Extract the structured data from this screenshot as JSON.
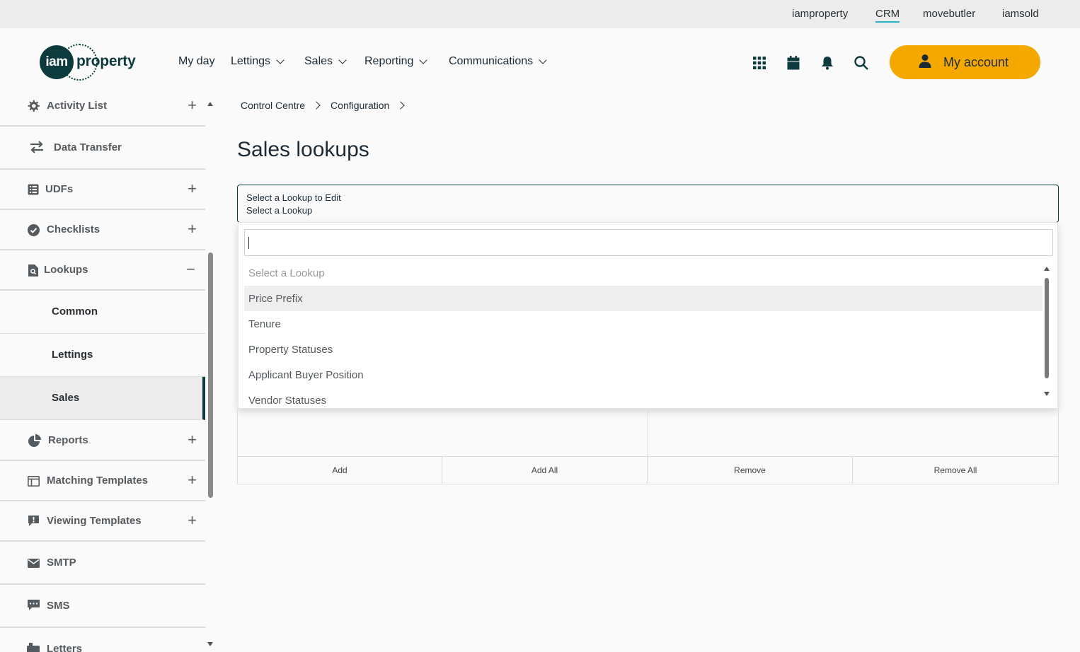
{
  "topbar": {
    "products": [
      "iamproperty",
      "CRM",
      "movebutler",
      "iamsold"
    ],
    "active": "CRM",
    "active_color": "#2bb3c8"
  },
  "header": {
    "logo": {
      "circle_text": "iam",
      "text": "property"
    },
    "nav": [
      {
        "label": "My day",
        "dropdown": false
      },
      {
        "label": "Lettings",
        "dropdown": true
      },
      {
        "label": "Sales",
        "dropdown": true
      },
      {
        "label": "Reporting",
        "dropdown": true
      },
      {
        "label": "Communications",
        "dropdown": true
      }
    ],
    "icons": [
      "apps-grid-icon",
      "calendar-icon",
      "bell-icon",
      "search-icon"
    ],
    "account_label": "My account",
    "account_color": "#f5a800"
  },
  "sidebar": {
    "items": [
      {
        "label": "Activity List",
        "icon": "gear-icon",
        "expand": "+"
      },
      {
        "label": "Data Transfer",
        "icon": "transfer-arrows-icon",
        "expand": ""
      },
      {
        "label": "UDFs",
        "icon": "list-icon",
        "expand": "+"
      },
      {
        "label": "Checklists",
        "icon": "check-circle-icon",
        "expand": "+"
      },
      {
        "label": "Lookups",
        "icon": "document-search-icon",
        "expand": "−"
      },
      {
        "label": "Reports",
        "icon": "pie-chart-icon",
        "expand": "+"
      },
      {
        "label": "Matching Templates",
        "icon": "template-icon",
        "expand": "+"
      },
      {
        "label": "Viewing Templates",
        "icon": "alert-message-icon",
        "expand": "+"
      },
      {
        "label": "SMTP",
        "icon": "envelope-icon",
        "expand": ""
      },
      {
        "label": "SMS",
        "icon": "sms-icon",
        "expand": ""
      },
      {
        "label": "Letters",
        "icon": "letter-icon",
        "expand": ""
      }
    ],
    "lookups_sub": [
      {
        "label": "Common"
      },
      {
        "label": "Lettings"
      },
      {
        "label": "Sales"
      }
    ],
    "selected_sub": "Sales"
  },
  "main": {
    "breadcrumb": [
      "Control Centre",
      "Configuration"
    ],
    "title": "Sales lookups",
    "select": {
      "label": "Select a Lookup to Edit",
      "value": "Select a Lookup"
    },
    "dropdown": {
      "search_value": "",
      "options": [
        "Select a Lookup",
        "Price Prefix",
        "Tenure",
        "Property Statuses",
        "Applicant Buyer Position",
        "Vendor Statuses"
      ],
      "hovered": "Price Prefix"
    },
    "buttons": {
      "add": "Add",
      "add_all": "Add All",
      "remove": "Remove",
      "remove_all": "Remove All"
    }
  }
}
